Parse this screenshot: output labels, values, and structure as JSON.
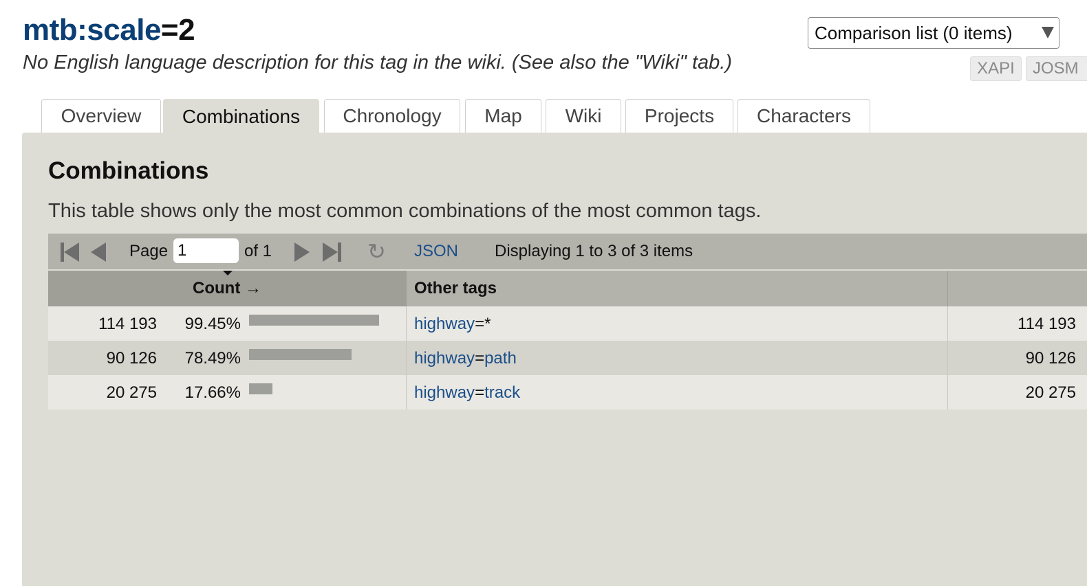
{
  "header": {
    "title_key": "mtb:scale",
    "title_eq": "=",
    "title_value": "2",
    "subtitle": "No English language description for this tag in the wiki. (See also the \"Wiki\" tab.)",
    "comparison_label": "Comparison list (0 items)",
    "ext_buttons": [
      "XAPI",
      "JOSM"
    ]
  },
  "tabs": [
    "Overview",
    "Combinations",
    "Chronology",
    "Map",
    "Wiki",
    "Projects",
    "Characters"
  ],
  "active_tab": "Combinations",
  "section": {
    "heading": "Combinations",
    "description": "This table shows only the most common combinations of the most common tags."
  },
  "pager": {
    "page_label": "Page",
    "page_value": "1",
    "of_label": "of 1",
    "json_label": "JSON",
    "display_text": "Displaying 1 to 3 of 3 items"
  },
  "table": {
    "col_count": "Count →",
    "col_tags": "Other tags",
    "rows": [
      {
        "count": "114 193",
        "percent": "99.45%",
        "fraction": 0.9945,
        "tag_key": "highway",
        "tag_value": "*",
        "count2": "114 193"
      },
      {
        "count": "90 126",
        "percent": "78.49%",
        "fraction": 0.7849,
        "tag_key": "highway",
        "tag_value": "path",
        "count2": "90 126"
      },
      {
        "count": "20 275",
        "percent": "17.66%",
        "fraction": 0.1766,
        "tag_key": "highway",
        "tag_value": "track",
        "count2": "20 275"
      }
    ]
  },
  "colors": {
    "panel_bg": "#deddd5",
    "link": "#1b4f8a",
    "title_key": "#0b3f75"
  }
}
